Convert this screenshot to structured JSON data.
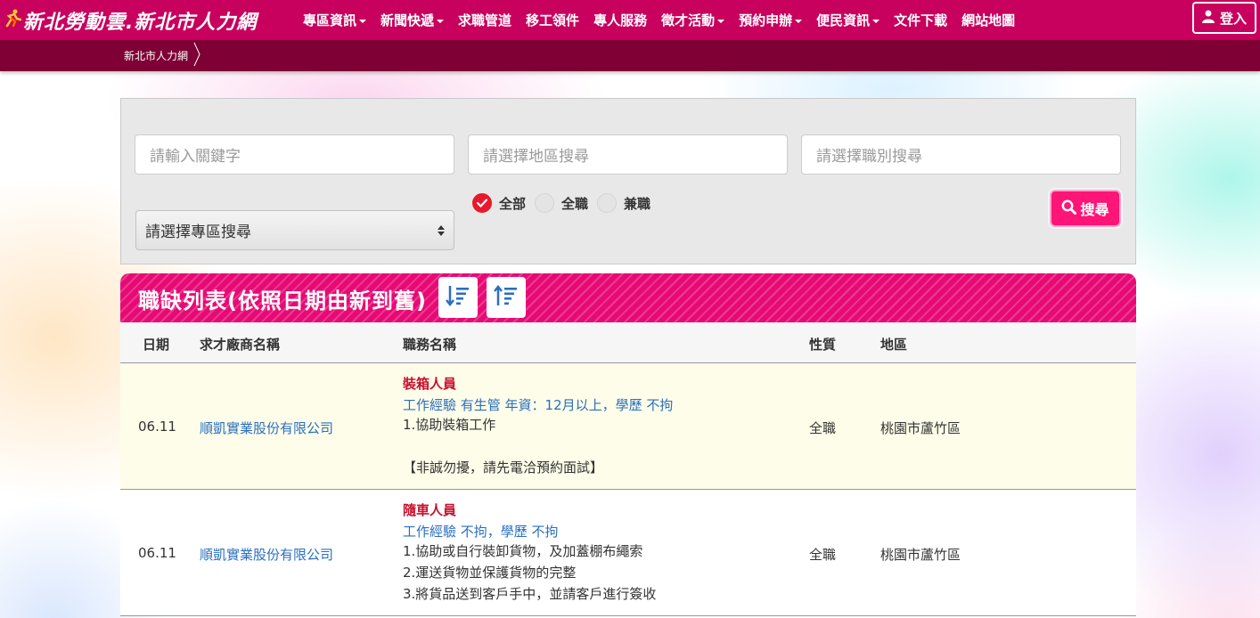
{
  "logo": {
    "text": "新北勞動雲.新北市人力網"
  },
  "nav": {
    "items": [
      {
        "label": "專區資訊",
        "dropdown": true
      },
      {
        "label": "新聞快遞",
        "dropdown": true
      },
      {
        "label": "求職管道",
        "dropdown": false
      },
      {
        "label": "移工領件",
        "dropdown": false
      },
      {
        "label": "專人服務",
        "dropdown": false
      },
      {
        "label": "徵才活動",
        "dropdown": true
      },
      {
        "label": "預約申辦",
        "dropdown": true
      },
      {
        "label": "便民資訊",
        "dropdown": true
      },
      {
        "label": "文件下載",
        "dropdown": false
      },
      {
        "label": "網站地圖",
        "dropdown": false
      }
    ],
    "login_label": "登入"
  },
  "breadcrumb": {
    "current": "新北市人力網"
  },
  "search": {
    "keyword_placeholder": "請輸入關鍵字",
    "area_placeholder": "請選擇地區搜尋",
    "category_placeholder": "請選擇職別搜尋",
    "zone_select": "請選擇專區搜尋",
    "radios": [
      {
        "label": "全部",
        "checked": true
      },
      {
        "label": "全職",
        "checked": false
      },
      {
        "label": "兼職",
        "checked": false
      }
    ],
    "button_label": "搜尋"
  },
  "list": {
    "title": "職缺列表(依照日期由新到舊)",
    "columns": {
      "date": "日期",
      "company": "求才廠商名稱",
      "job": "職務名稱",
      "type": "性質",
      "area": "地區"
    },
    "rows": [
      {
        "date": "06.11",
        "company": "順凱實業股份有限公司",
        "job_title": "裝箱人員",
        "job_req": "工作經驗 有生管 年資：12月以上，學歷 不拘",
        "desc_lines": [
          "1.協助裝箱工作",
          "",
          "【非誠勿擾，請先電洽預約面試】"
        ],
        "type": "全職",
        "area": "桃園市蘆竹區"
      },
      {
        "date": "06.11",
        "company": "順凱實業股份有限公司",
        "job_title": "隨車人員",
        "job_req": "工作經驗 不拘，學歷 不拘",
        "desc_lines": [
          "1.協助或自行裝卸貨物，及加蓋棚布繩索",
          "2.運送貨物並保護貨物的完整",
          "3.將貨品送到客戶手中，並請客戶進行簽收"
        ],
        "type": "全職",
        "area": "桃園市蘆竹區"
      }
    ]
  },
  "colors": {
    "navbar": "#c8005e",
    "crumb_bar": "#7e0034",
    "accent": "#ff1477",
    "link": "#2a6fbf",
    "job_title": "#c8102e"
  }
}
